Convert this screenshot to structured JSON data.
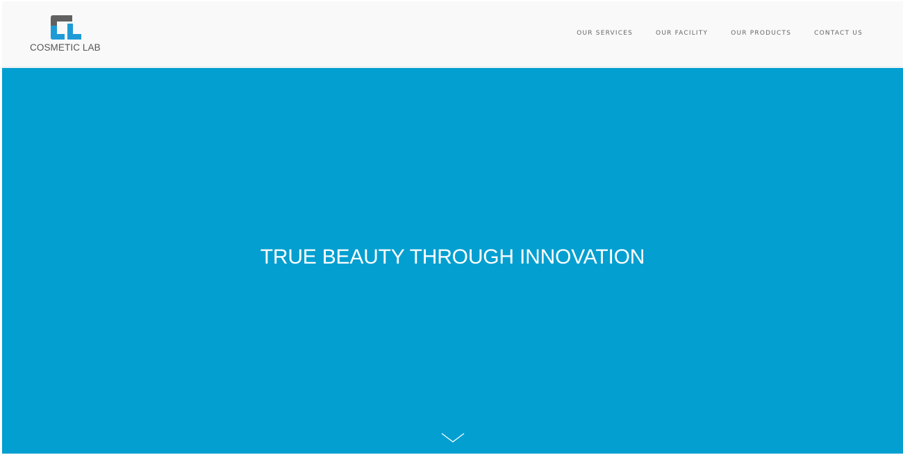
{
  "header": {
    "logo": {
      "mark_letters": "CL",
      "text": "COSMETIC LAB",
      "colors": {
        "dark": "#616161",
        "blue": "#1e9bd7"
      }
    },
    "nav": {
      "items": [
        {
          "label": "OUR SERVICES"
        },
        {
          "label": "OUR FACILITY"
        },
        {
          "label": "OUR PRODUCTS"
        },
        {
          "label": "CONTACT US"
        }
      ]
    }
  },
  "hero": {
    "background": "#039fd0",
    "title": "TRUE BEAUTY THROUGH INNOVATION",
    "scroll_icon": "chevron-down-icon"
  }
}
